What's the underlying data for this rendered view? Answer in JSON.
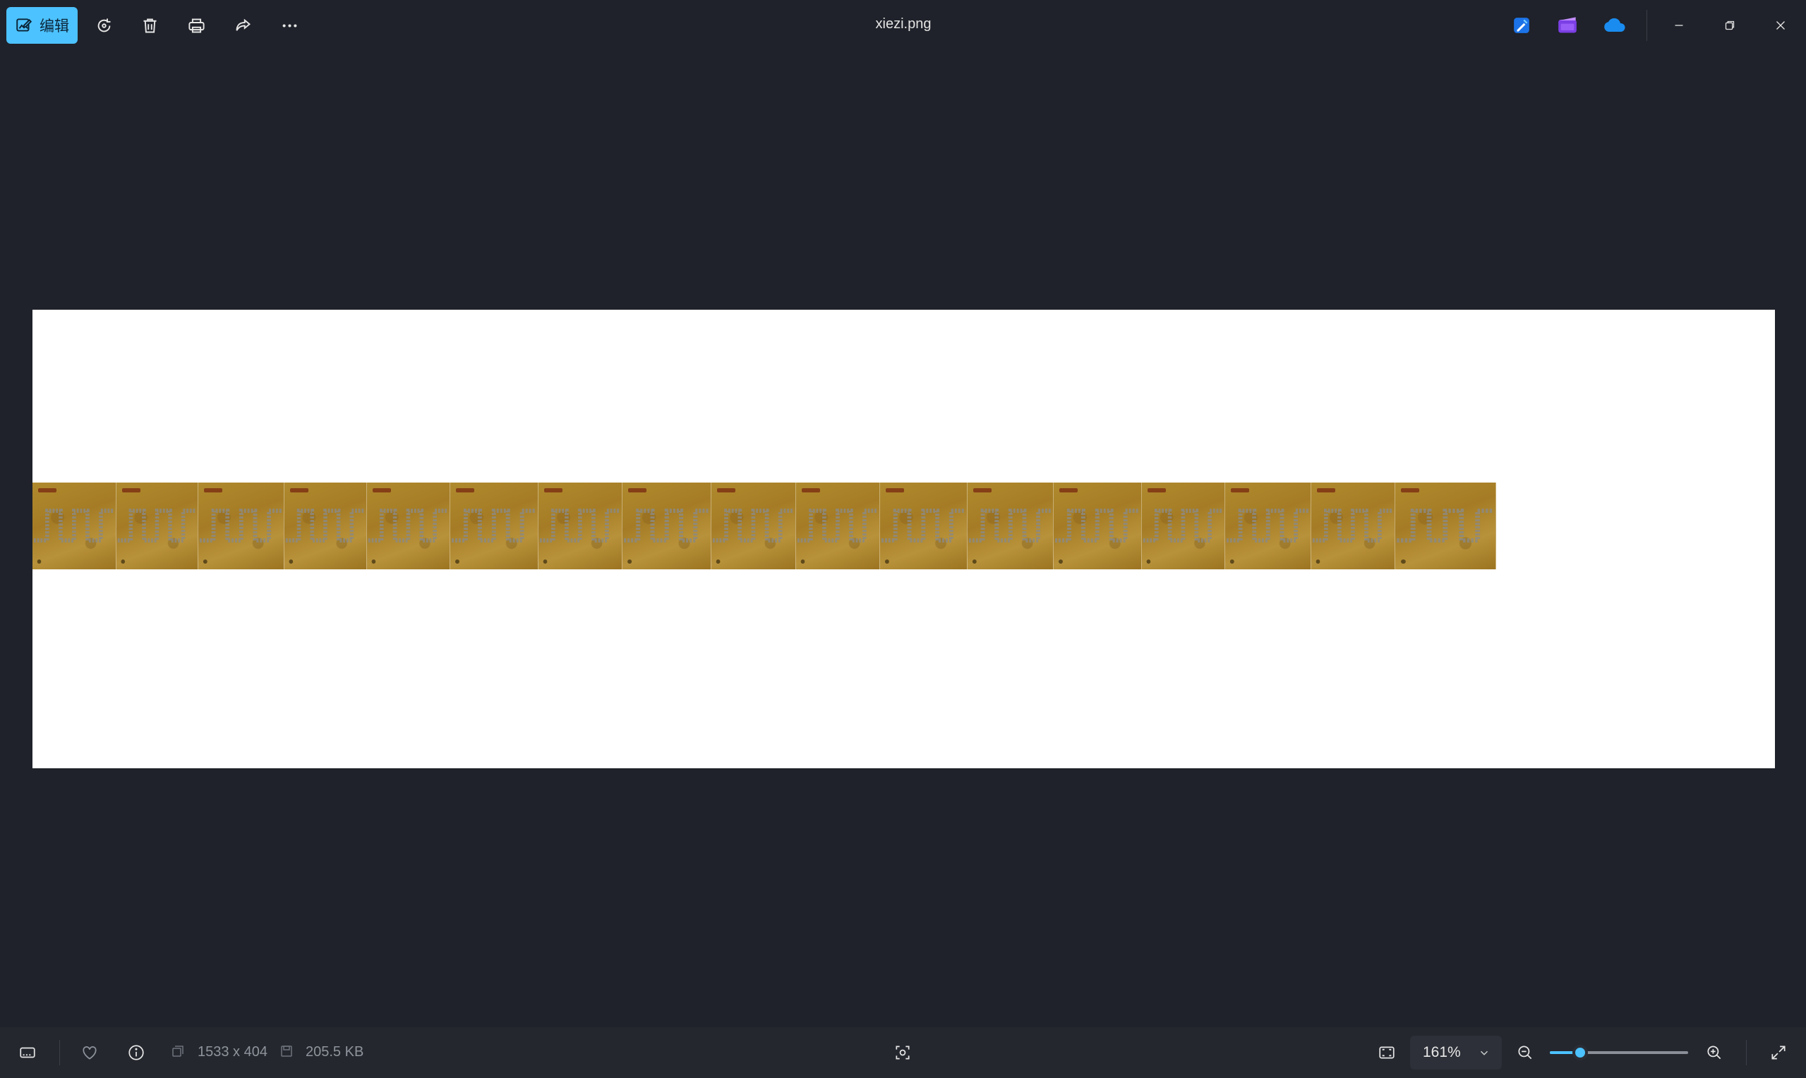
{
  "toolbar": {
    "edit_label": "编辑",
    "tools": [
      {
        "name": "rotate-icon"
      },
      {
        "name": "delete-icon"
      },
      {
        "name": "print-icon"
      },
      {
        "name": "share-icon"
      },
      {
        "name": "more-icon"
      }
    ]
  },
  "window": {
    "title": "xiezi.png",
    "apps": [
      "designer-app-icon",
      "clipchamp-app-icon",
      "onedrive-icon"
    ],
    "controls": [
      "minimize-icon",
      "restore-icon",
      "close-icon"
    ]
  },
  "image": {
    "background": "#ffffff",
    "tile_color": "#a98226",
    "tile_count": 17
  },
  "statusbar": {
    "dimensions": "1533 x 404",
    "file_size": "205.5 KB",
    "zoom_label": "161%",
    "zoom_level": 0.22
  },
  "colors": {
    "accent": "#4cc2ff",
    "background": "#1f222a",
    "bar": "#24272e"
  }
}
